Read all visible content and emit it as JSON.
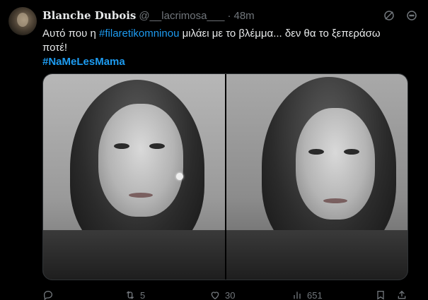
{
  "tweet": {
    "display_name": "Blanche Dubois",
    "handle": "@__lacrimosa___",
    "separator": "·",
    "time": "48m",
    "text_line1_pre": "Αυτό που η ",
    "hashtag1": "#filaretikomninou",
    "text_line1_post": " μιλάει με το βλέμμα... δεν θα το ξεπεράσω",
    "text_line2": "ποτέ!",
    "hashtag2": "#NaMeLesMama"
  },
  "actions": {
    "reply_count": "",
    "retweet_count": "5",
    "like_count": "30",
    "views_count": "651"
  },
  "icons": {
    "header_1": "grok-slash-icon",
    "header_2": "more-options-icon",
    "reply": "reply-icon",
    "retweet": "retweet-icon",
    "like": "heart-icon",
    "views": "views-icon",
    "bookmark": "bookmark-icon",
    "share": "share-icon"
  },
  "colors": {
    "background": "#000000",
    "text": "#e7e9ea",
    "muted": "#71767b",
    "link": "#1d9bf0"
  }
}
